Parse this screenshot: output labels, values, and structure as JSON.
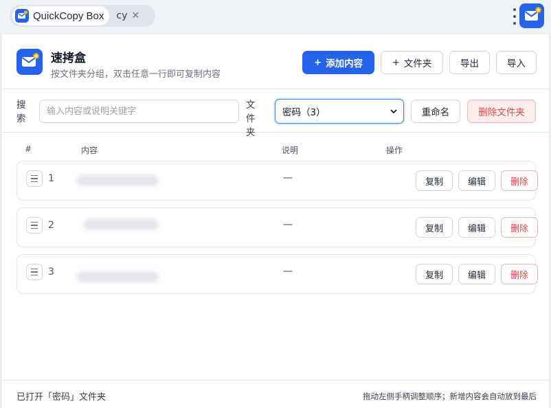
{
  "tabs": {
    "app_title": "QuickCopy Box",
    "tab2_label": "cy"
  },
  "header": {
    "title": "速拷盒",
    "subtitle": "按文件夹分组，双击任意一行即可复制内容",
    "add_content_label": "添加内容",
    "folder_button_label": "文件夹",
    "export_label": "导出",
    "import_label": "导入"
  },
  "filter": {
    "search_label": "搜索",
    "search_placeholder": "输入内容或说明关键字",
    "search_value": "",
    "folder_label": "文件夹",
    "folder_selected": "密码（3）",
    "rename_label": "重命名",
    "delete_folder_label": "删除文件夹"
  },
  "table": {
    "columns": {
      "index": "#",
      "content": "内容",
      "description": "说明",
      "actions": "操作"
    },
    "rows": [
      {
        "num": "1",
        "description": "—",
        "copy": "复制",
        "edit": "编辑",
        "delete": "删除"
      },
      {
        "num": "2",
        "description": "—",
        "copy": "复制",
        "edit": "编辑",
        "delete": "删除"
      },
      {
        "num": "3",
        "description": "—",
        "copy": "复制",
        "edit": "编辑",
        "delete": "删除"
      }
    ]
  },
  "footer": {
    "status": "已打开「密码」文件夹",
    "hint": "拖动左侧手柄调整顺序；新增内容会自动放到最后"
  },
  "colors": {
    "accent": "#2563eb",
    "danger": "#e14a4a",
    "icon_badge": "#f5b400"
  },
  "icons": {
    "app_logo": "envelope-plus-icon",
    "close": "close-icon",
    "menu": "kebab-menu-icon",
    "drag": "drag-handle-icon",
    "dropdown": "chevron-down-icon"
  }
}
